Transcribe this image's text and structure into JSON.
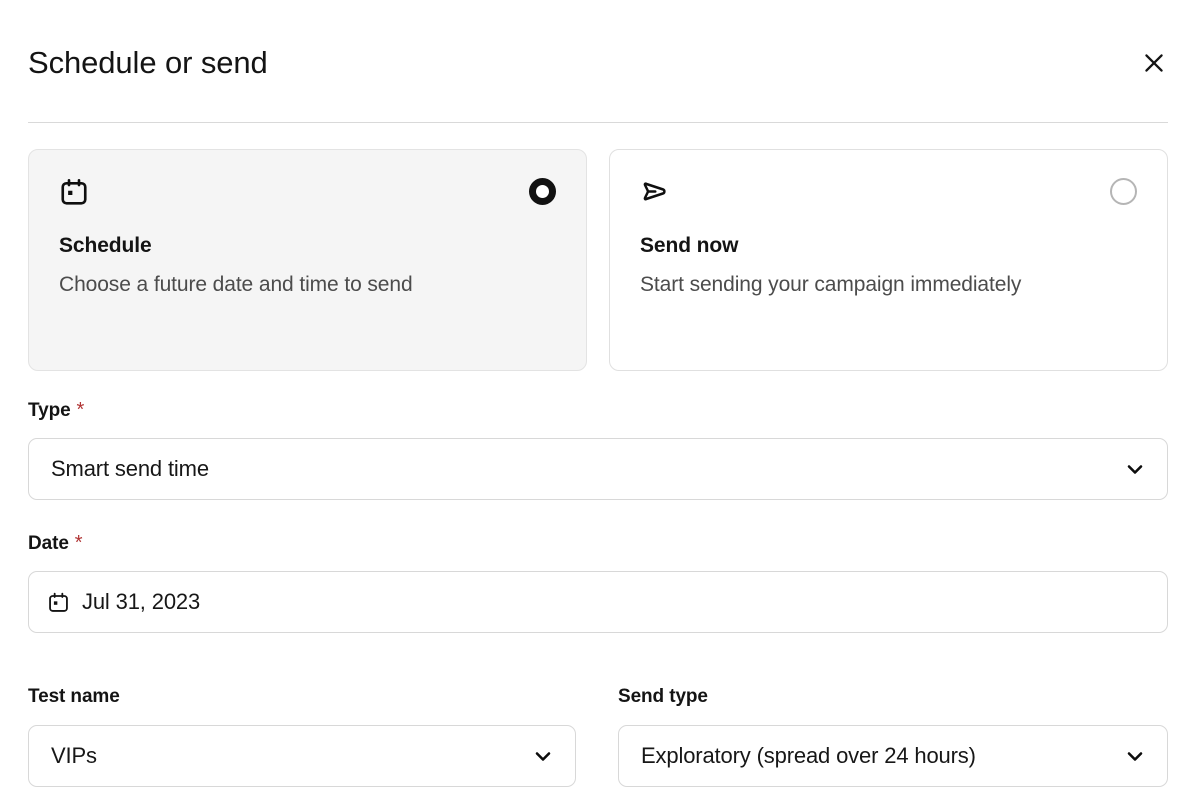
{
  "header": {
    "title": "Schedule or send",
    "close_icon": "close-icon"
  },
  "options": [
    {
      "icon": "calendar-icon",
      "title": "Schedule",
      "description": "Choose a future date and time to send",
      "selected": true
    },
    {
      "icon": "send-icon",
      "title": "Send now",
      "description": "Start sending your campaign immediately",
      "selected": false
    }
  ],
  "fields": {
    "type": {
      "label": "Type",
      "required_marker": "*",
      "value": "Smart send time",
      "chevron_icon": "chevron-down-icon"
    },
    "date": {
      "label": "Date",
      "required_marker": "*",
      "value": "Jul 31, 2023",
      "icon": "calendar-icon"
    },
    "test_name": {
      "label": "Test name",
      "value": "VIPs",
      "chevron_icon": "chevron-down-icon"
    },
    "send_type": {
      "label": "Send type",
      "value": "Exploratory (spread over 24 hours)",
      "chevron_icon": "chevron-down-icon"
    }
  },
  "colors": {
    "required": "#b03434",
    "selected_card_bg": "#f5f5f5",
    "border": "#d8d8d8",
    "text": "#141414",
    "muted_text": "#4c4c4c"
  }
}
